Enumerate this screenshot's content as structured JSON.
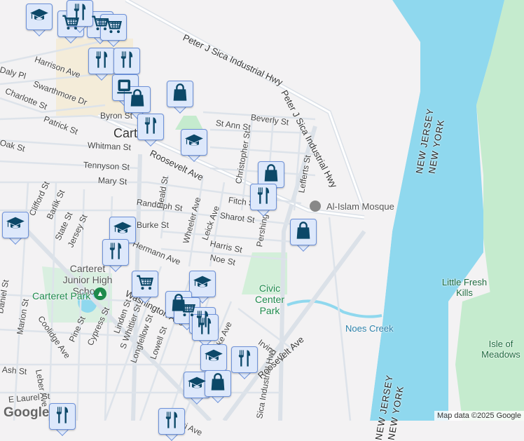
{
  "town": "Carteret",
  "streets": [
    "Harrison Ave",
    "Swarthmore Dr",
    "Charlotte St",
    "Patrick St",
    "Byron St",
    "Whitman St",
    "Tennyson St",
    "Mary St",
    "Randolph St",
    "Burke St",
    "Hermann Ave",
    "Harris St",
    "Noe St",
    "Sharot St",
    "Fitch St",
    "St Ann St",
    "Beverly St",
    "Christopher St",
    "Pershing Ave",
    "Lefferts St",
    "Roosevelt Ave",
    "Washington Ave",
    "Heald St",
    "Wheeler Ave",
    "Leick Ave",
    "Oak St",
    "Daly Pl",
    "Clifford St",
    "Barlik St",
    "State St",
    "Jersey St",
    "Linden St",
    "S Whittier St",
    "Longfellow St",
    "Lowell St",
    "Cypress St",
    "Pine St",
    "Coolidge Ave",
    "Marion St",
    "Leber Ave",
    "Ash St",
    "E Laurel St",
    "Daniel St",
    "Irving St",
    "Cooke Ave",
    "Pulaski Ave",
    "Peter J Sica Industrial Hwy",
    "Peter J Sica Industrial Hwy",
    "Sica Industrial Hwy",
    "Roosevelt Ave"
  ],
  "places": {
    "school": "Carteret Junior High School",
    "park": "Carteret Park",
    "civic": "Civic Center Park",
    "mosque": "Al-Islam Mosque",
    "creek": "Noes Creek",
    "kills": "Little Fresh Kills",
    "isle": "Isle of Meadows"
  },
  "states": {
    "nj": "NEW JERSEY",
    "ny": "NEW YORK",
    "nj2": "NEW JERSEY",
    "ny2": "NEW YORK"
  },
  "markers": [
    "school",
    "shopping-cart",
    "shopping-cart",
    "shopping-cart",
    "restaurant",
    "restaurant",
    "restaurant",
    "coffee",
    "shopping-bag",
    "shopping-bag",
    "restaurant",
    "school",
    "shopping-bag",
    "restaurant",
    "shopping-bag",
    "school",
    "school",
    "restaurant",
    "shopping-cart",
    "school",
    "shopping-bag",
    "shopping-cart",
    "restaurant",
    "restaurant",
    "school",
    "restaurant",
    "school",
    "shopping-bag",
    "restaurant",
    "restaurant"
  ],
  "colors": {
    "water": "#8fd8ee",
    "green": "#c5ebce",
    "marker_bg": "#dde8fb",
    "marker_border": "#6d91d8",
    "icon": "#0c4868"
  },
  "attribution": "Map data ©2025 Google",
  "logo": "Google"
}
